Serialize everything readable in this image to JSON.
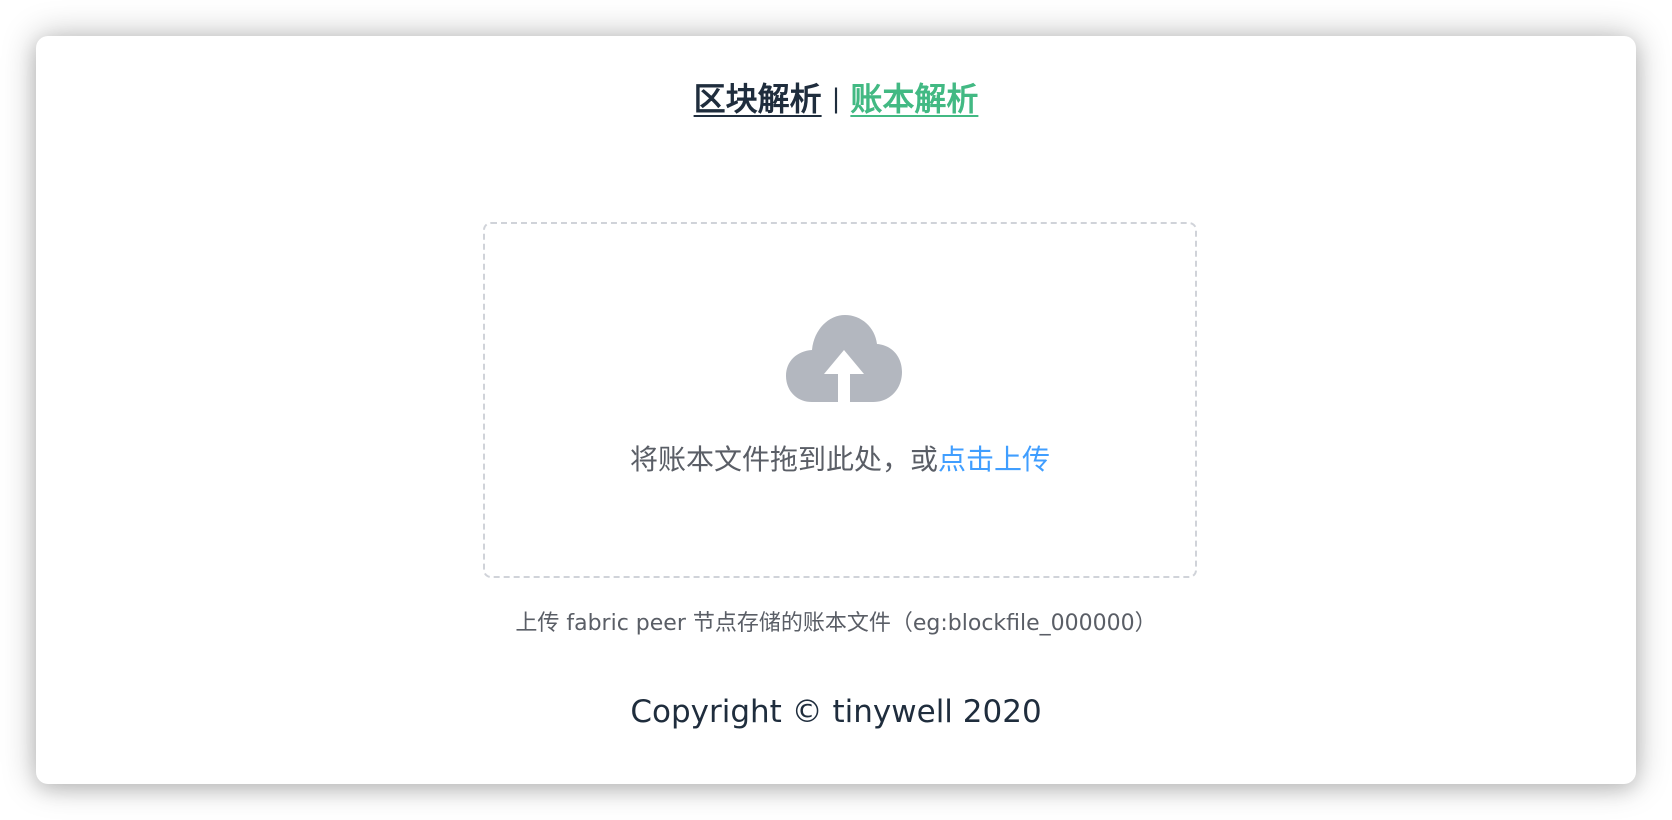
{
  "nav": {
    "block_parse_label": "区块解析",
    "separator": "|",
    "ledger_parse_label": "账本解析"
  },
  "upload": {
    "icon": "cloud-upload-icon",
    "drop_text": "将账本文件拖到此处，或",
    "click_upload_label": "点击上传",
    "hint": "上传 fabric peer 节点存储的账本文件（eg:blockfile_000000）"
  },
  "footer": {
    "copyright": "Copyright © tinywell 2020"
  },
  "colors": {
    "text_dark": "#1f2d3d",
    "accent_green": "#42b983",
    "link_blue": "#409eff",
    "icon_gray": "#b3b7bf",
    "dashed_border": "#d0d3d9"
  }
}
